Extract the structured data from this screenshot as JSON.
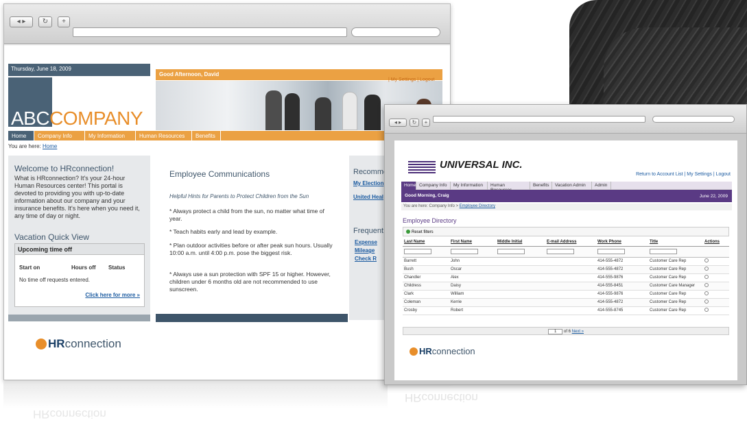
{
  "win1": {
    "date": "Thursday, June 18, 2009",
    "logo_abc": "ABC",
    "logo_company": "COMPANY",
    "greeting": "Good Afternoon, David",
    "header_links": "| My Settings | Logout",
    "tabs": [
      "Home",
      "Company Info",
      "My Information",
      "Human Resources",
      "Benefits"
    ],
    "breadcrumb_label": "You are here:",
    "breadcrumb_link": "Home",
    "welcome": {
      "title": "Welcome to HRconnection!",
      "text": "What is HRconnection? It's your 24-hour Human Resources center! This portal is devoted to providing you with up-to-date information about our company and your insurance benefits. It's here when you need it, any time of day or night."
    },
    "vacation": {
      "title": "Vacation Quick View",
      "box_title": "Upcoming time off",
      "col_start": "Start on",
      "col_hours": "Hours off",
      "col_status": "Status",
      "empty": "No time off requests entered.",
      "more_link": "Click here for more »"
    },
    "comms": {
      "title": "Employee Communications",
      "intro": "Helpful Hints for Parents to Protect Children from the Sun",
      "p1": "* Always protect a child from the sun, no matter what time of year.",
      "p2": "* Teach habits early and lead by example.",
      "p3": "* Plan outdoor activities before or after peak sun hours. Usually 10:00 a.m. until 4:00 p.m. pose the biggest risk.",
      "p4": "* Always use a sun protection with SPF 15 or higher. However, children under 6 months old are not recommended to use sunscreen."
    },
    "right": {
      "title": "Recomme",
      "link1": "My Election",
      "link2": "United Heal",
      "title2": "Frequent",
      "link3": "Expense",
      "link4": "Mileage",
      "link5": "Check R"
    },
    "hr_logo_bold": "HR",
    "hr_logo_rest": "connection"
  },
  "win2": {
    "logo": "UNIVERSAL INC.",
    "links": "Return to Account List | My Settings | Logout",
    "tabs": [
      "Home",
      "Company Info",
      "My Information",
      "Human Resources",
      "Benefits",
      "Vacation Admin",
      "Admin"
    ],
    "greeting": "Good Morning, Craig",
    "date": "June 22, 2009",
    "breadcrumb_label": "You are here: Company Info >",
    "breadcrumb_link": "Employee Directory",
    "title": "Employee Directory",
    "reset_label": "Reset filters",
    "columns": [
      "Last Name",
      "First Name",
      "Middle Initial",
      "E-mail Address",
      "Work Phone",
      "Title",
      "Actions"
    ],
    "rows": [
      [
        "Barrett",
        "John",
        "",
        "",
        "414-555-4872",
        "Customer Care Rep"
      ],
      [
        "Bush",
        "Oscar",
        "",
        "",
        "414-555-4872",
        "Customer Care Rep"
      ],
      [
        "Chandler",
        "Alex",
        "",
        "",
        "414-555-9876",
        "Customer Care Rep"
      ],
      [
        "Childress",
        "Daisy",
        "",
        "",
        "414-555-8451",
        "Customer Care Manager"
      ],
      [
        "Clark",
        "William",
        "",
        "",
        "414-555-9876",
        "Customer Care Rep"
      ],
      [
        "Coleman",
        "Kerrie",
        "",
        "",
        "414-555-4872",
        "Customer Care Rep"
      ],
      [
        "Crosby",
        "Robert",
        "",
        "",
        "414-555-8745",
        "Customer Care Rep"
      ]
    ],
    "pager_page": "1",
    "pager_of": "of 6",
    "pager_next": "Next »",
    "hr_logo_bold": "HR",
    "hr_logo_rest": "connection"
  },
  "reflection": "HRconnection"
}
